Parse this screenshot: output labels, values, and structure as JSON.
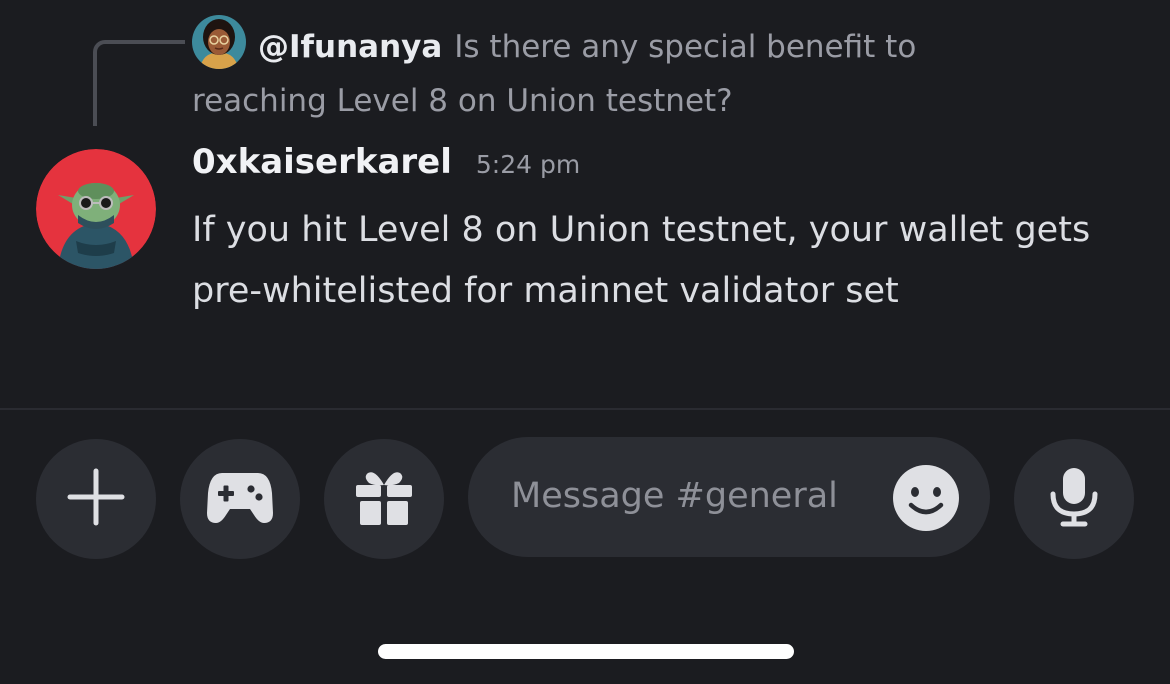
{
  "reply": {
    "author": "@Ifunanya",
    "text": "Is there any special benefit to reaching Level 8 on Union testnet?",
    "avatar_icon": "user-avatar-ifunanya"
  },
  "message": {
    "author": "0xkaiserkarel",
    "timestamp": "5:24 pm",
    "body": "If you hit Level 8 on Union testnet, your wallet gets pre-whitelisted for mainnet validator set",
    "avatar_icon": "user-avatar-0xkaiserkarel"
  },
  "composer": {
    "placeholder": "Message #general",
    "buttons": [
      "plus-icon",
      "gamepad-icon",
      "gift-icon",
      "emoji-icon",
      "microphone-icon"
    ]
  },
  "colors": {
    "background": "#1b1c20",
    "button_bg": "#2b2d33",
    "text_primary": "#f1f2f5",
    "text_muted": "#9a9ca5",
    "avatar_red": "#e5333e"
  }
}
